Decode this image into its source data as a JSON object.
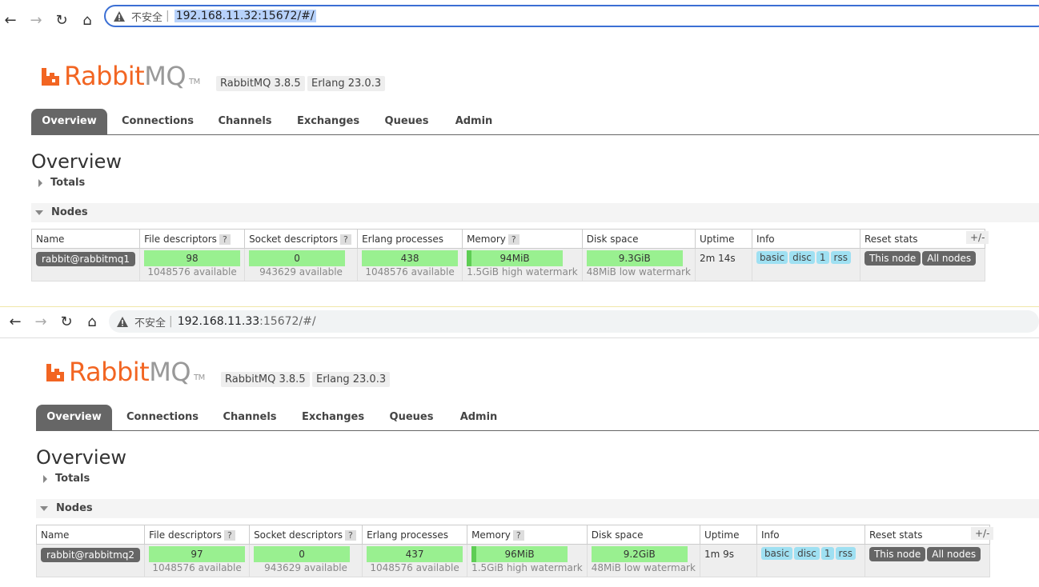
{
  "panels": [
    {
      "browser": {
        "security_label": "不安全",
        "url_host": "192.168.11.32",
        "url_rest": ":15672/#/"
      },
      "app": {
        "logo_rabbit": "Rabbit",
        "logo_mq": "MQ",
        "logo_tm": "TM",
        "rabbitmq_version": "RabbitMQ 3.8.5",
        "erlang_version": "Erlang 23.0.3",
        "tabs": [
          "Overview",
          "Connections",
          "Channels",
          "Exchanges",
          "Queues",
          "Admin"
        ],
        "page_title": "Overview",
        "totals_label": "Totals",
        "nodes_label": "Nodes",
        "columns": [
          "Name",
          "File descriptors",
          "Socket descriptors",
          "Erlang processes",
          "Memory",
          "Disk space",
          "Uptime",
          "Info",
          "Reset stats"
        ],
        "help_mark": "?",
        "plus_minus": "+/-",
        "node": {
          "name": "rabbit@rabbitmq1",
          "file_descriptors": "98",
          "file_available": "1048576 available",
          "socket_descriptors": "0",
          "socket_available": "943629 available",
          "erlang_processes": "438",
          "erlang_available": "1048576 available",
          "memory": "94MiB",
          "memory_watermark": "1.5GiB high watermark",
          "disk_space": "9.3GiB",
          "disk_watermark": "48MiB low watermark",
          "uptime": "2m 14s",
          "info": [
            "basic",
            "disc",
            "1",
            "rss"
          ],
          "reset_this": "This node",
          "reset_all": "All nodes"
        }
      }
    },
    {
      "browser": {
        "security_label": "不安全",
        "url_host": "192.168.11.33",
        "url_rest": ":15672/#/"
      },
      "app": {
        "logo_rabbit": "Rabbit",
        "logo_mq": "MQ",
        "logo_tm": "TM",
        "rabbitmq_version": "RabbitMQ 3.8.5",
        "erlang_version": "Erlang 23.0.3",
        "tabs": [
          "Overview",
          "Connections",
          "Channels",
          "Exchanges",
          "Queues",
          "Admin"
        ],
        "page_title": "Overview",
        "totals_label": "Totals",
        "nodes_label": "Nodes",
        "columns": [
          "Name",
          "File descriptors",
          "Socket descriptors",
          "Erlang processes",
          "Memory",
          "Disk space",
          "Uptime",
          "Info",
          "Reset stats"
        ],
        "help_mark": "?",
        "plus_minus": "+/-",
        "node": {
          "name": "rabbit@rabbitmq2",
          "file_descriptors": "97",
          "file_available": "1048576 available",
          "socket_descriptors": "0",
          "socket_available": "943629 available",
          "erlang_processes": "437",
          "erlang_available": "1048576 available",
          "memory": "96MiB",
          "memory_watermark": "1.5GiB high watermark",
          "disk_space": "9.2GiB",
          "disk_watermark": "48MiB low watermark",
          "uptime": "1m 9s",
          "info": [
            "basic",
            "disc",
            "1",
            "rss"
          ],
          "reset_this": "This node",
          "reset_all": "All nodes"
        }
      }
    }
  ]
}
